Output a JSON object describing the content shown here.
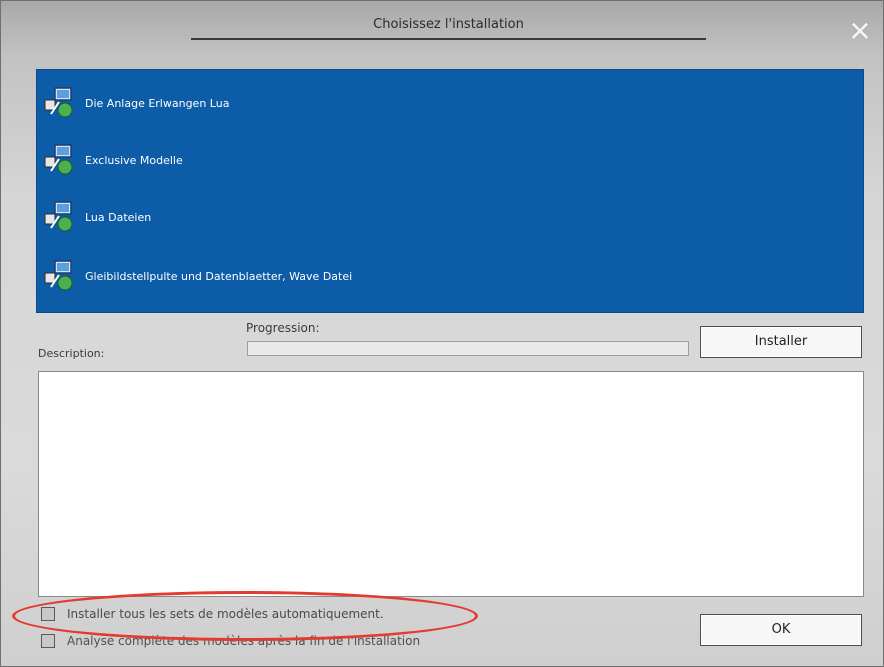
{
  "dialog": {
    "title": "Choisissez l'installation",
    "close_icon": "close-icon"
  },
  "install_list": {
    "items": [
      {
        "label": "Die Anlage Erlwangen Lua",
        "icon": "install-package-icon"
      },
      {
        "label": "Exclusive Modelle",
        "icon": "install-package-icon"
      },
      {
        "label": "Lua Dateien",
        "icon": "install-package-icon"
      },
      {
        "label": "Gleibildstellpulte und Datenblaetter, Wave Datei",
        "icon": "install-package-icon"
      }
    ],
    "background": "#0c5ca8"
  },
  "progress": {
    "label": "Progression:",
    "value": 0
  },
  "buttons": {
    "install_label": "Installer",
    "ok_label": "OK"
  },
  "description": {
    "label": "Description:",
    "text": ""
  },
  "options": {
    "auto_install_label": "Installer tous les sets de modèles automatiquement.",
    "auto_install_checked": false,
    "full_scan_label": "Analyse complète des modèles après la fin de l'installation",
    "full_scan_checked": false
  },
  "colors": {
    "accent": "#0c5ca8",
    "highlight": "#e33b2d"
  }
}
